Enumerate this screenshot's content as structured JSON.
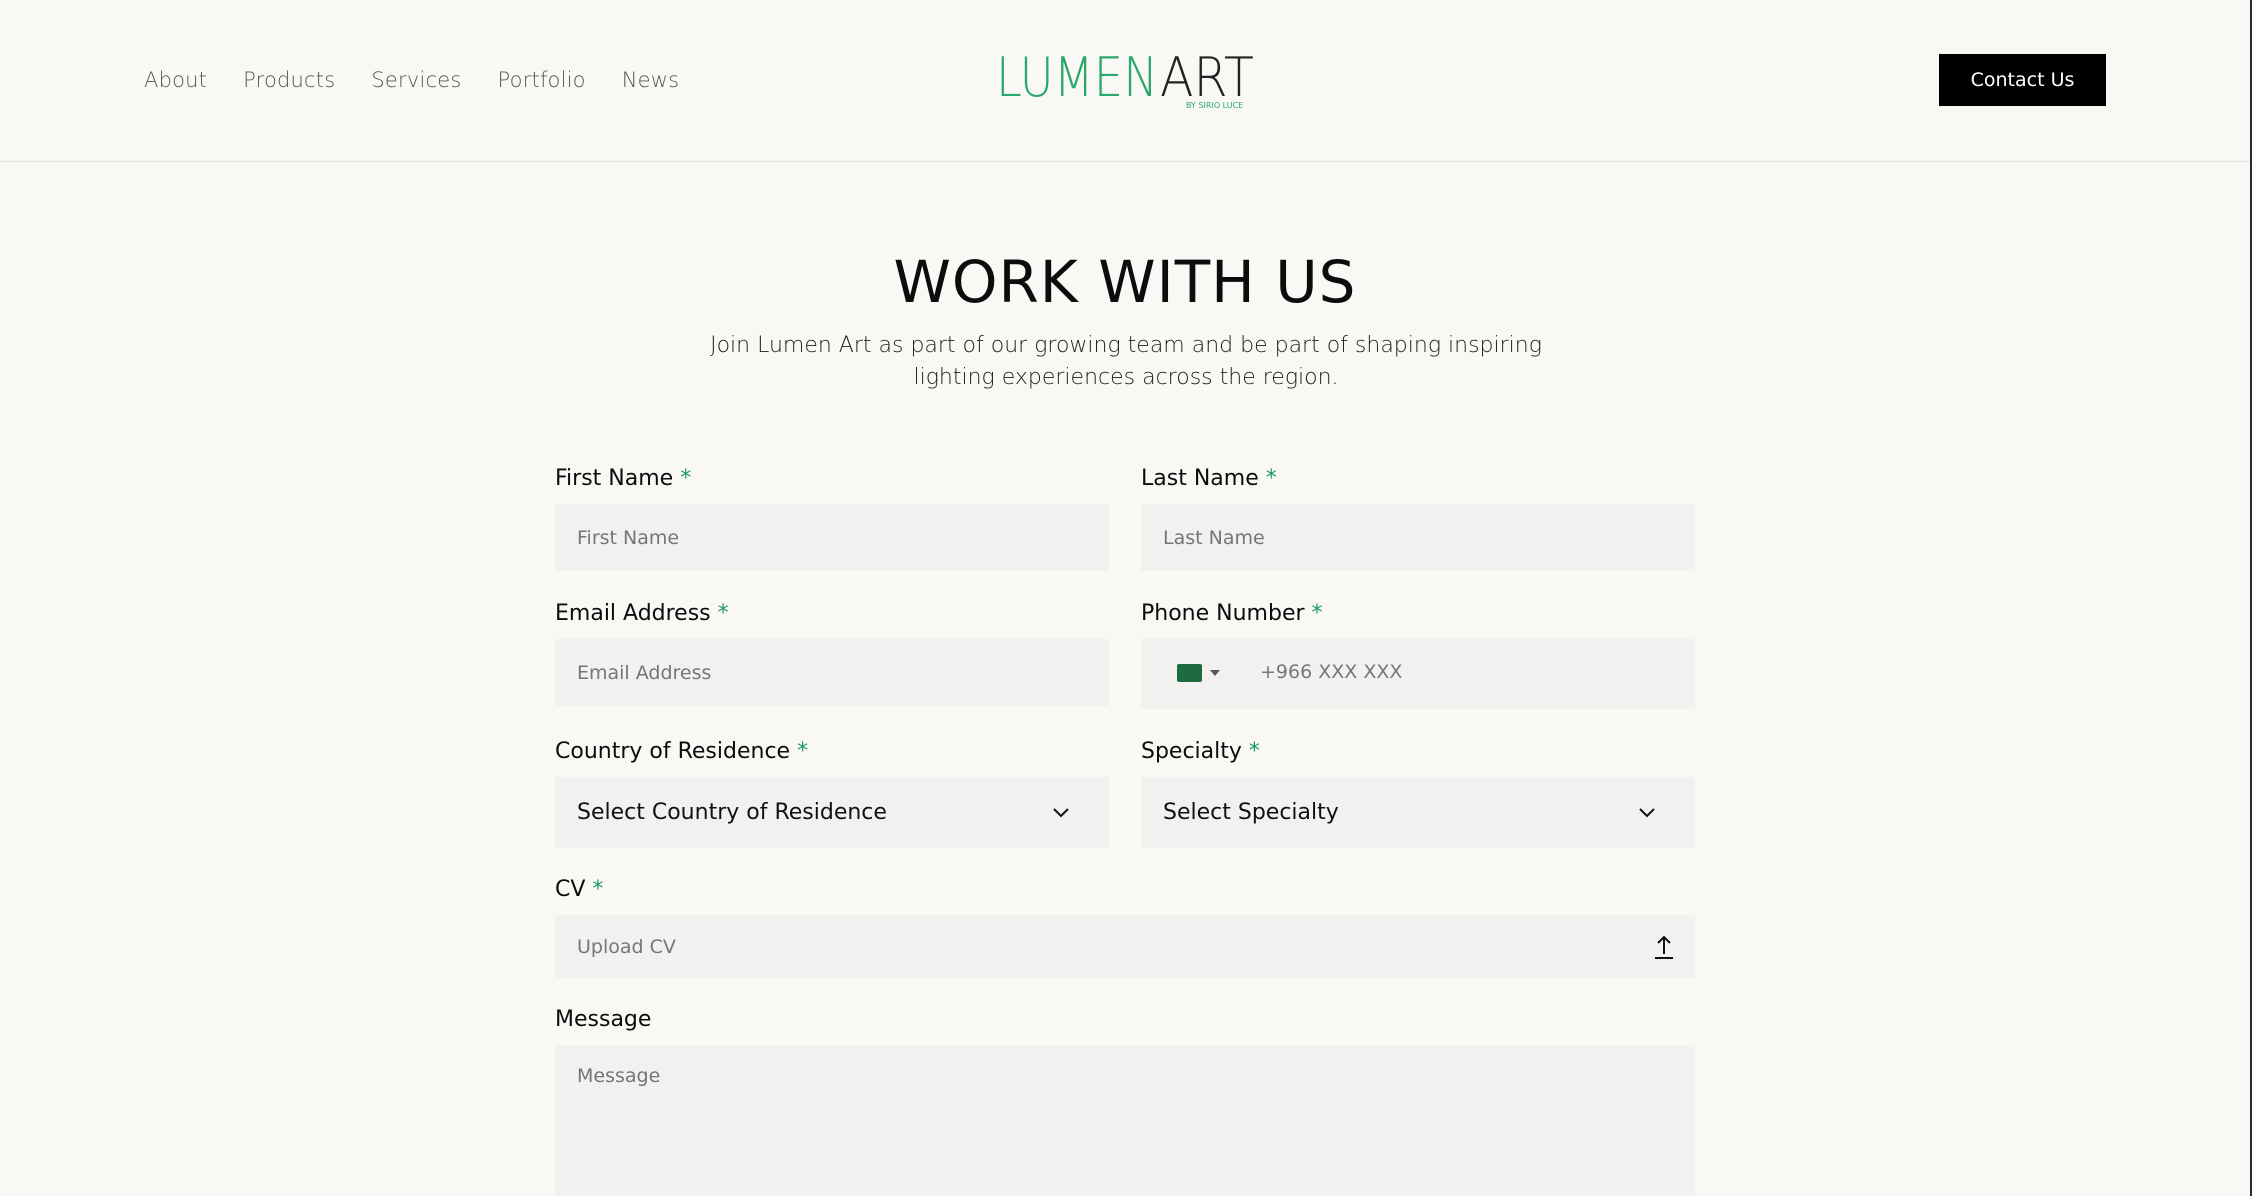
{
  "nav": {
    "items": [
      "About",
      "Products",
      "Services",
      "Portfolio",
      "News"
    ]
  },
  "logo": {
    "text_a": "LUMEN",
    "text_b": "ART",
    "sub": "BY SIRIO LUCE",
    "accent": "#2aa86b"
  },
  "header": {
    "contact_label": "Contact Us"
  },
  "hero": {
    "title": "WORK WITH US",
    "subtitle": "Join Lumen Art as part of our growing team and be part of shaping inspiring lighting experiences across the region."
  },
  "form": {
    "first_name": {
      "label": "First Name",
      "placeholder": "First Name"
    },
    "last_name": {
      "label": "Last Name",
      "placeholder": "Last Name"
    },
    "email": {
      "label": "Email Address",
      "placeholder": "Email Address"
    },
    "phone": {
      "label": "Phone Number",
      "placeholder": "+966 XXX XXX",
      "flag": "saudi-arabia-flag-icon"
    },
    "country": {
      "label": "Country of Residence",
      "selected": "Select Country of Residence"
    },
    "specialty": {
      "label": "Specialty",
      "selected": "Select Specialty"
    },
    "cv": {
      "label": "CV",
      "placeholder": "Upload CV"
    },
    "message": {
      "label": "Message",
      "placeholder": "Message"
    },
    "required_mark": "*"
  },
  "colors": {
    "background": "#f9f8f5",
    "field_bg": "#f2f1ef",
    "required": "#1f9a5f",
    "button_bg": "#000000"
  }
}
